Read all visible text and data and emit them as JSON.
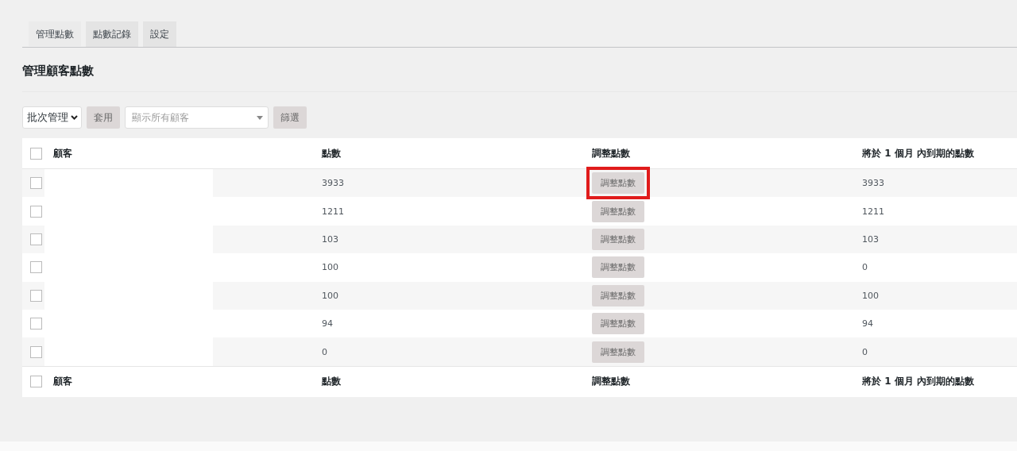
{
  "tabs": [
    {
      "label": "管理點數",
      "selected": true
    },
    {
      "label": "點數記錄",
      "selected": false
    },
    {
      "label": "設定",
      "selected": false
    }
  ],
  "heading": "管理顧客點數",
  "toolbar": {
    "bulk_action": "批次管理",
    "apply": "套用",
    "customer_filter": {
      "placeholder": "顯示所有顧客"
    },
    "filter": "篩選"
  },
  "table": {
    "header_checked": false,
    "columns": [
      "顧客",
      "點數",
      "調整點數",
      "將於 1 個月 內到期的點數"
    ],
    "rows": [
      {
        "checked": false,
        "points": "3933",
        "action": "調整點數",
        "expiring": "3933",
        "highlighted": true
      },
      {
        "checked": false,
        "points": "1211",
        "action": "調整點數",
        "expiring": "1211",
        "highlighted": false
      },
      {
        "checked": false,
        "points": "103",
        "action": "調整點數",
        "expiring": "103",
        "highlighted": false
      },
      {
        "checked": false,
        "points": "100",
        "action": "調整點數",
        "expiring": "0",
        "highlighted": false
      },
      {
        "checked": false,
        "points": "100",
        "action": "調整點數",
        "expiring": "100",
        "highlighted": false
      },
      {
        "checked": false,
        "points": "94",
        "action": "調整點數",
        "expiring": "94",
        "highlighted": false
      },
      {
        "checked": false,
        "points": "0",
        "action": "調整點數",
        "expiring": "0",
        "highlighted": false
      }
    ],
    "footer_checked": false,
    "footer_columns": [
      "顧客",
      "點數",
      "調整點數",
      "將於 1 個月 內到期的點數"
    ]
  }
}
